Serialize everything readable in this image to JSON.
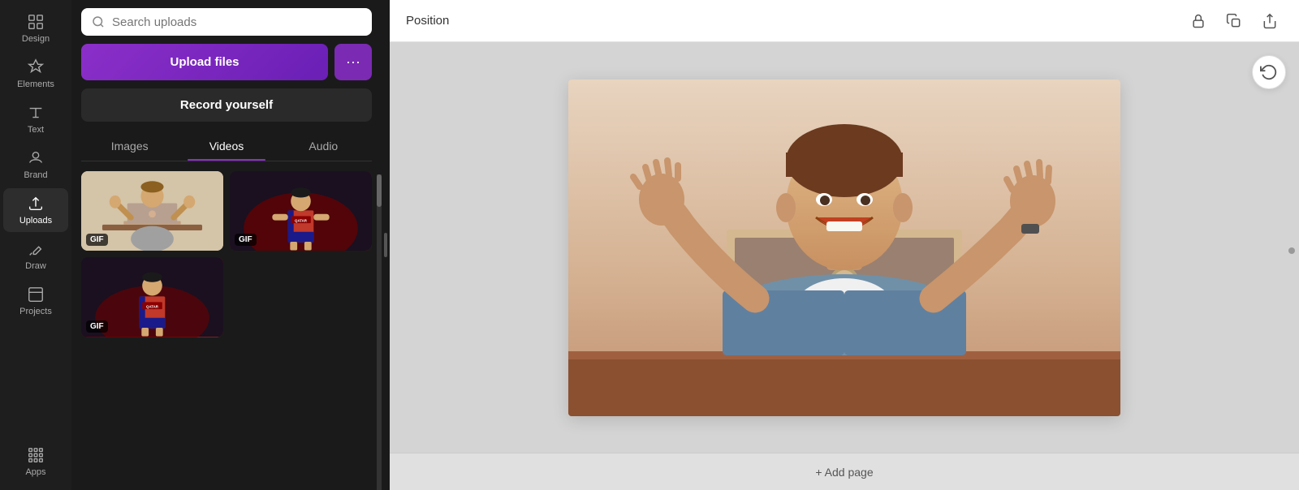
{
  "sidebar": {
    "items": [
      {
        "id": "design",
        "label": "Design",
        "icon": "design"
      },
      {
        "id": "elements",
        "label": "Elements",
        "icon": "elements"
      },
      {
        "id": "text",
        "label": "Text",
        "icon": "text"
      },
      {
        "id": "brand",
        "label": "Brand",
        "icon": "brand"
      },
      {
        "id": "uploads",
        "label": "Uploads",
        "icon": "uploads",
        "active": true
      },
      {
        "id": "draw",
        "label": "Draw",
        "icon": "draw"
      },
      {
        "id": "projects",
        "label": "Projects",
        "icon": "projects"
      },
      {
        "id": "apps",
        "label": "Apps",
        "icon": "apps"
      }
    ]
  },
  "upload_panel": {
    "search_placeholder": "Search uploads",
    "upload_btn_label": "Upload files",
    "more_btn_label": "···",
    "record_btn_label": "Record yourself",
    "tabs": [
      {
        "id": "images",
        "label": "Images",
        "active": false
      },
      {
        "id": "videos",
        "label": "Videos",
        "active": true
      },
      {
        "id": "audio",
        "label": "Audio",
        "active": false
      }
    ],
    "media_items": [
      {
        "id": "gif1",
        "badge": "GIF",
        "type": "person-laptop"
      },
      {
        "id": "gif2",
        "badge": "GIF",
        "type": "soccer-player"
      },
      {
        "id": "gif3",
        "badge": "GIF",
        "type": "soccer-player-small"
      }
    ]
  },
  "toolbar": {
    "position_label": "Position",
    "lock_icon": "lock",
    "copy_icon": "copy",
    "share_icon": "share"
  },
  "canvas": {
    "add_page_label": "+ Add page",
    "refresh_icon": "refresh"
  },
  "colors": {
    "upload_btn": "#8b2fc9",
    "active_tab_underline": "#8b2fc9",
    "sidebar_bg": "#1e1e1e",
    "panel_bg": "#1a1a1a"
  }
}
